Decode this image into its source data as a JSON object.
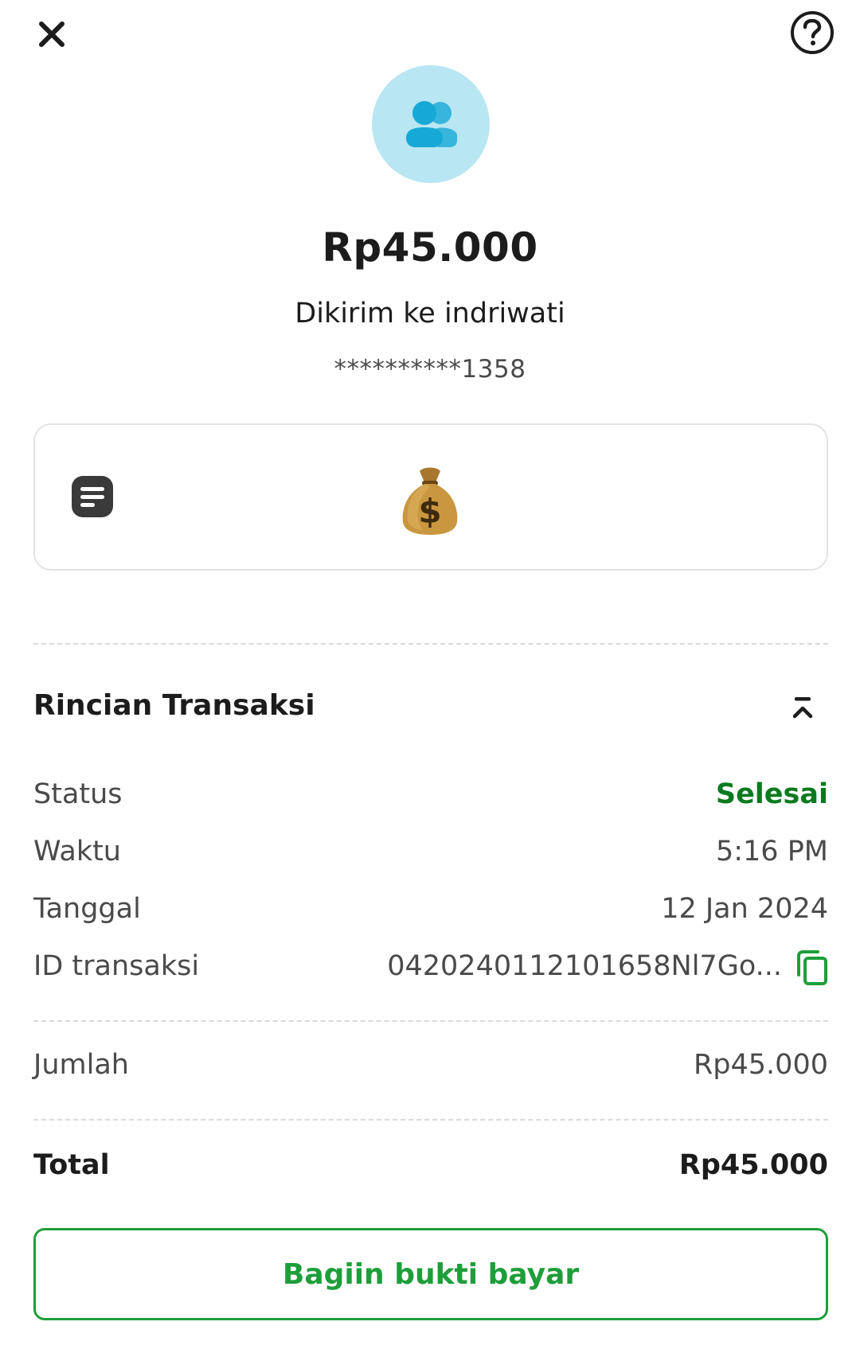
{
  "header": {
    "close_icon": "close-icon",
    "help_icon": "help-icon"
  },
  "recipient": {
    "avatar_icon": "users-icon",
    "amount": "Rp45.000",
    "sent_to": "Dikirim ke indriwati",
    "account_masked": "**********1358"
  },
  "note": {
    "note_icon": "note-icon",
    "content_emoji": "money-bag-emoji"
  },
  "details": {
    "title": "Rincian Transaksi",
    "collapse_icon": "collapse-up-icon",
    "status_label": "Status",
    "status_value": "Selesai",
    "time_label": "Waktu",
    "time_value": "5:16 PM",
    "date_label": "Tanggal",
    "date_value": "12 Jan 2024",
    "txid_label": "ID transaksi",
    "txid_value": "042024011210165​8Nl7Go...",
    "copy_icon": "copy-icon",
    "amount_label": "Jumlah",
    "amount_value": "Rp45.000",
    "total_label": "Total",
    "total_value": "Rp45.000"
  },
  "actions": {
    "share_label": "Bagiin bukti bayar"
  },
  "colors": {
    "accent_green": "#1e9e3a",
    "status_green": "#0b7a1f",
    "avatar_bg": "#b9e6f3",
    "avatar_fg": "#17a9d6"
  }
}
